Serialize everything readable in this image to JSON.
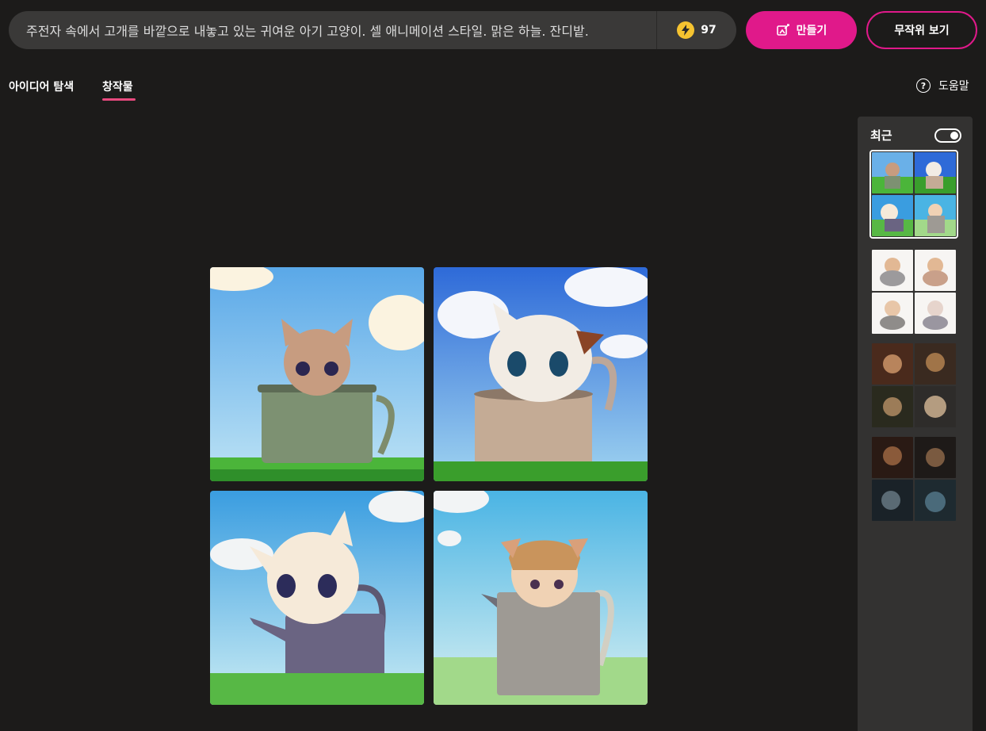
{
  "search": {
    "prompt": "주전자 속에서 고개를 바깥으로 내놓고 있는 귀여운 아기 고양이. 셀 애니메이션 스타일. 맑은 하늘. 잔디밭."
  },
  "credits": {
    "count": "97",
    "icon": "lightning-bolt-icon"
  },
  "actions": {
    "create_label": "만들기",
    "random_label": "무작위 보기"
  },
  "tabs": [
    {
      "label": "아이디어 탐색"
    },
    {
      "label": "창작물"
    }
  ],
  "help": {
    "label": "도움말",
    "icon": "question-circle-icon"
  },
  "sidebar": {
    "title": "최근",
    "toggle_on": true
  },
  "colors": {
    "accent": "#e0198a",
    "tab_underline": "#e84a7f",
    "background": "#1c1b1a",
    "panel": "#333231"
  }
}
